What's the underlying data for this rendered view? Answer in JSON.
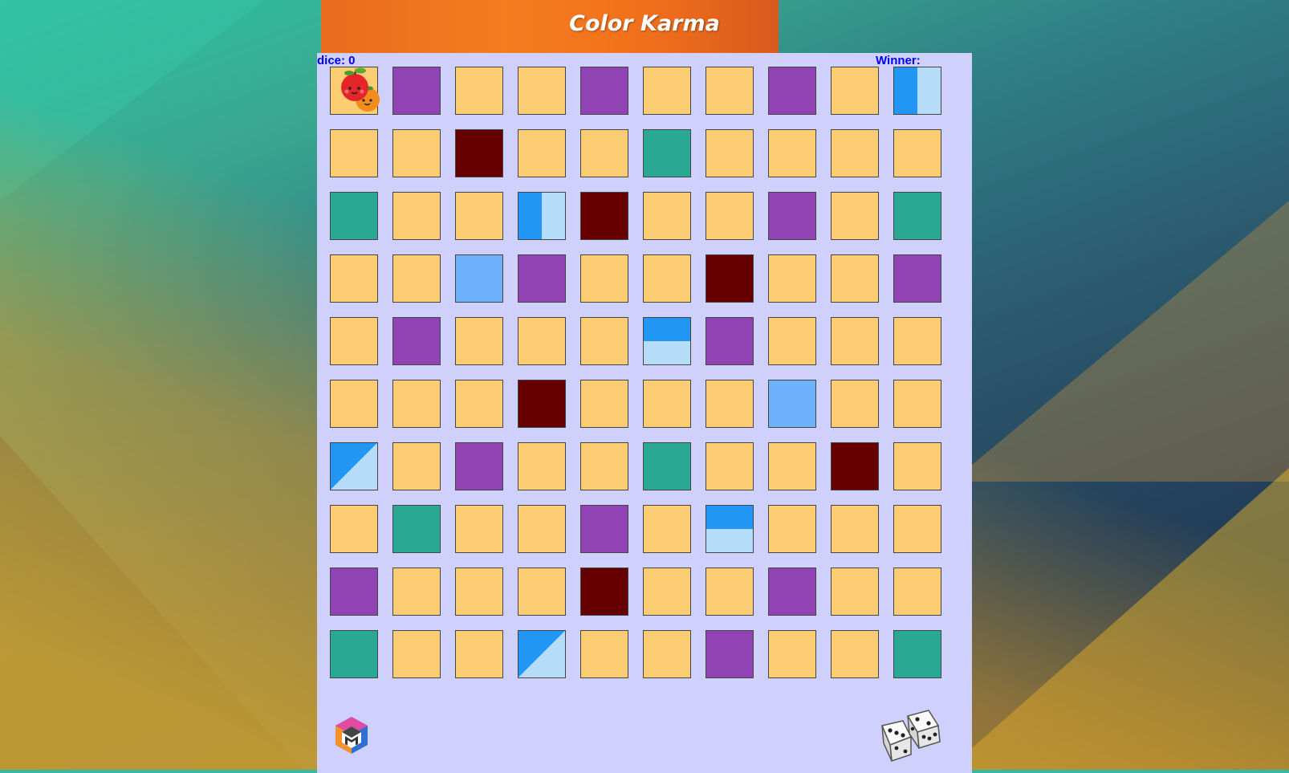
{
  "title": "Color Karma",
  "status": {
    "dice_label": "dice: 0",
    "winner_label": "Winner:"
  },
  "colors": {
    "y": "#fccd72",
    "p": "#9243b3",
    "d": "#660000",
    "t": "#2aa893",
    "l": "#6db1fa",
    "blue": "#2196f3",
    "pale_blue": "#b5dcf8",
    "board": "#cfd0fb"
  },
  "cell_legend": {
    "y": "yellow",
    "p": "purple",
    "d": "dark-red",
    "t": "teal",
    "l": "light-blue",
    "bv": "blue-split-vertical",
    "bh": "blue-split-horizontal",
    "bd": "blue-split-diagonal"
  },
  "grid": [
    [
      "y",
      "p",
      "y",
      "y",
      "p",
      "y",
      "y",
      "p",
      "y",
      "bv"
    ],
    [
      "y",
      "y",
      "d",
      "y",
      "y",
      "t",
      "y",
      "y",
      "y",
      "y"
    ],
    [
      "t",
      "y",
      "y",
      "bv",
      "d",
      "y",
      "y",
      "p",
      "y",
      "t"
    ],
    [
      "y",
      "y",
      "l",
      "p",
      "y",
      "y",
      "d",
      "y",
      "y",
      "p"
    ],
    [
      "y",
      "p",
      "y",
      "y",
      "y",
      "bh",
      "p",
      "y",
      "y",
      "y"
    ],
    [
      "y",
      "y",
      "y",
      "d",
      "y",
      "y",
      "y",
      "l",
      "y",
      "y"
    ],
    [
      "bd",
      "y",
      "p",
      "y",
      "y",
      "t",
      "y",
      "y",
      "d",
      "y"
    ],
    [
      "y",
      "t",
      "y",
      "y",
      "p",
      "y",
      "bh",
      "y",
      "y",
      "y"
    ],
    [
      "p",
      "y",
      "y",
      "y",
      "d",
      "y",
      "y",
      "p",
      "y",
      "y"
    ],
    [
      "t",
      "y",
      "y",
      "bd",
      "y",
      "y",
      "p",
      "y",
      "y",
      "t"
    ]
  ],
  "player_token": {
    "row": 0,
    "col": 0,
    "icon": "apple-and-orange-icon"
  },
  "icons": {
    "logo": "cube-logo-icon",
    "dice_button": "dice-icon"
  }
}
